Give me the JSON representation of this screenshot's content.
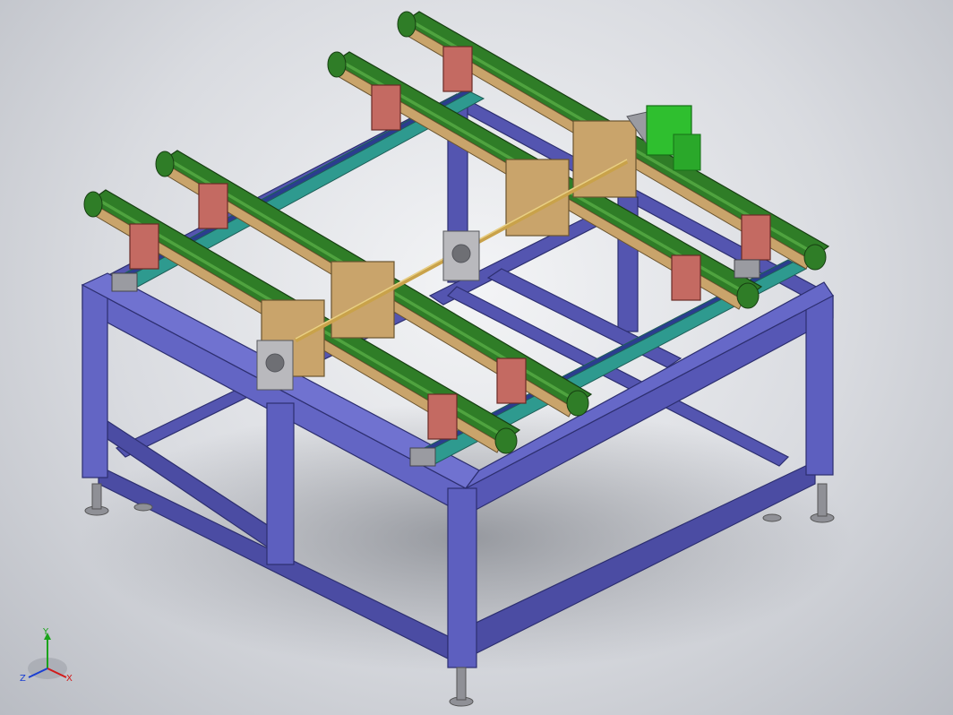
{
  "viewport": {
    "background": "#d9dbe0",
    "colors": {
      "frame": "#5455b0",
      "frame_dark": "#3d3f8f",
      "frame_light": "#6a6cc6",
      "rail": "#2e9a8f",
      "belt": "#2f7d27",
      "belt_light": "#4fa33f",
      "pulley_plate": "#c9a46b",
      "block": "#c46a62",
      "motor": "#2fbf2f",
      "shaft": "#c9a24a",
      "bearing": "#b9b9bd"
    }
  },
  "triad": {
    "x_label": "X",
    "y_label": "Y",
    "z_label": "Z",
    "x_color": "#d21a1a",
    "y_color": "#1aa31a",
    "z_color": "#1a3fd2"
  }
}
